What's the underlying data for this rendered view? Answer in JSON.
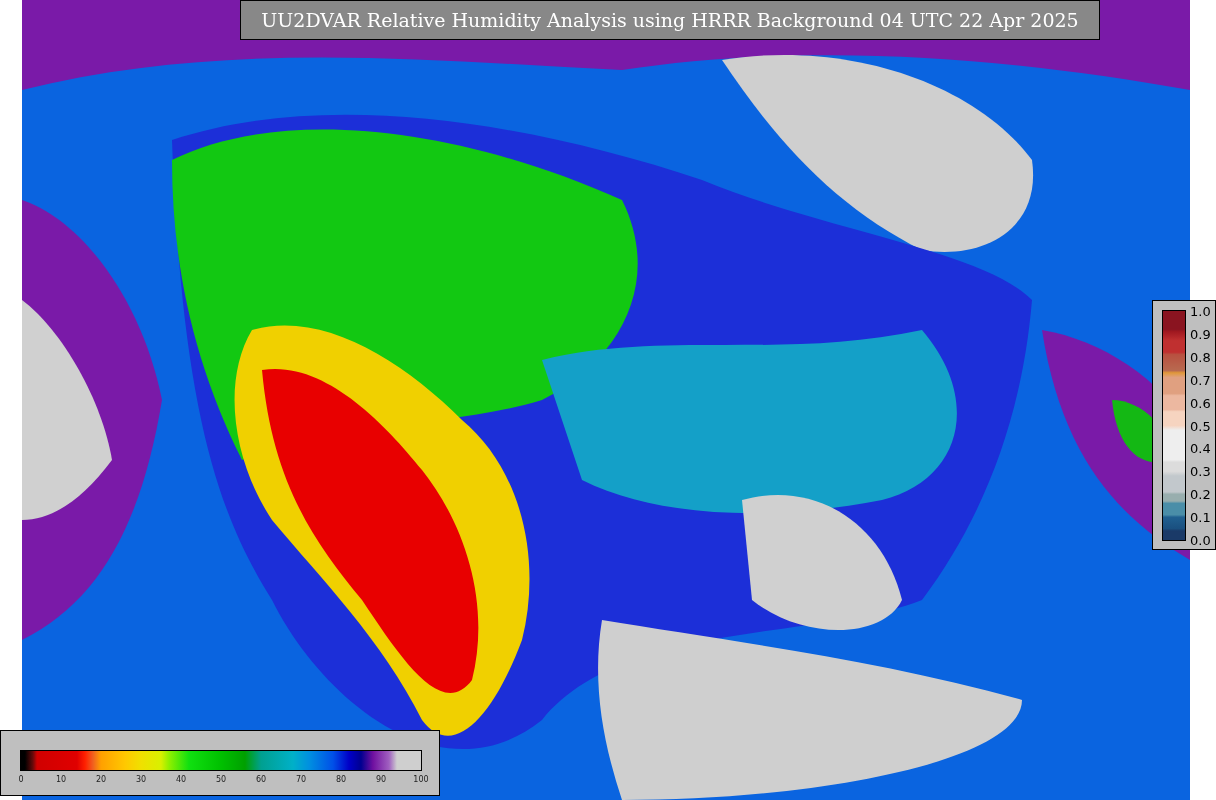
{
  "title": "UU2DVAR Relative Humidity Analysis using HRRR Background 04 UTC 22 Apr 2025",
  "humidity_colorbar": {
    "ticks": [
      "0",
      "10",
      "20",
      "30",
      "40",
      "50",
      "60",
      "70",
      "80",
      "90",
      "100"
    ]
  },
  "ratio_colorbar": {
    "ticks": [
      "1.0",
      "0.9",
      "0.8",
      "0.7",
      "0.6",
      "0.5",
      "0.4",
      "0.3",
      "0.2",
      "0.1",
      "0.0"
    ]
  }
}
